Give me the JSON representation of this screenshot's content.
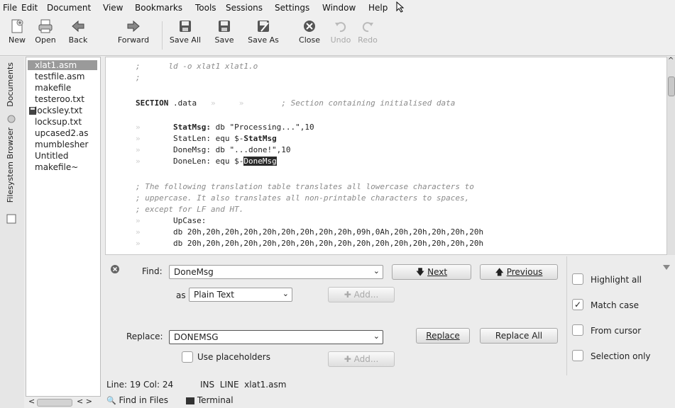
{
  "menubar": {
    "items": [
      {
        "label": "File"
      },
      {
        "label": "Edit"
      },
      {
        "label": "Document"
      },
      {
        "label": "View"
      },
      {
        "label": "Bookmarks"
      },
      {
        "label": "Tools"
      },
      {
        "label": "Sessions"
      },
      {
        "label": "Settings"
      },
      {
        "label": "Window"
      },
      {
        "label": "Help"
      }
    ]
  },
  "toolbar": {
    "new": "New",
    "open": "Open",
    "back": "Back",
    "forward": "Forward",
    "save_all": "Save All",
    "save": "Save",
    "save_as": "Save As",
    "close": "Close",
    "undo": "Undo",
    "redo": "Redo"
  },
  "sidetabs": {
    "documents": "Documents",
    "filesystem": "Filesystem Browser"
  },
  "documents": [
    {
      "name": "xlat1.asm"
    },
    {
      "name": "testfile.asm"
    },
    {
      "name": "makefile"
    },
    {
      "name": "testeroo.txt"
    },
    {
      "name": "locksley.txt"
    },
    {
      "name": "locksup.txt"
    },
    {
      "name": "upcased2.as"
    },
    {
      "name": "mumblesher"
    },
    {
      "name": "Untitled"
    },
    {
      "name": "makefile~"
    }
  ],
  "editor": {
    "lines": {
      "l1": ";      ld -o xlat1 xlat1.o",
      "l2": ";",
      "section_kw": "SECTION",
      "section_name": " .data",
      "section_comment": "; Section containing initialised data",
      "stat_name": "StatMsg:",
      "stat_rest": " db \"Processing...\",10",
      "statlen_name": "StatLen:",
      "statlen_rest": " equ $-",
      "statlen_ref": "StatMsg",
      "done_name": "DoneMsg:",
      "done_rest": " db \"...done!\",10",
      "donelen_name": "DoneLen:",
      "donelen_rest": " equ $-",
      "donelen_sel": "DoneMsg",
      "c1": "; The following translation table translates all lowercase characters to",
      "c2": "; uppercase. It also translates all non-printable characters to spaces,",
      "c3": "; except for LF and HT.",
      "upcase": "UpCase:",
      "db1": "db 20h,20h,20h,20h,20h,20h,20h,20h,20h,09h,0Ah,20h,20h,20h,20h,20h",
      "db2": "db 20h,20h,20h,20h,20h,20h,20h,20h,20h,20h,20h,20h,20h,20h,20h,20h"
    }
  },
  "find": {
    "find_label": "Find:",
    "find_value": "DoneMsg",
    "next": "Next",
    "previous": "Previous",
    "as_label": "as",
    "mode_value": "Plain Text",
    "add": "Add...",
    "replace_label": "Replace:",
    "replace_value": "DONEMSG",
    "replace_btn": "Replace",
    "replace_all": "Replace All",
    "use_placeholders": "Use placeholders",
    "add2": "Add...",
    "highlight_all": "Highlight all",
    "match_case": "Match case",
    "from_cursor": "From cursor",
    "selection_only": "Selection only",
    "match_case_checked": true
  },
  "status": {
    "position": "Line: 19 Col: 24",
    "mode": "INS  LINE  xlat1.asm",
    "find_in_files": "Find in Files",
    "terminal": "Terminal"
  }
}
